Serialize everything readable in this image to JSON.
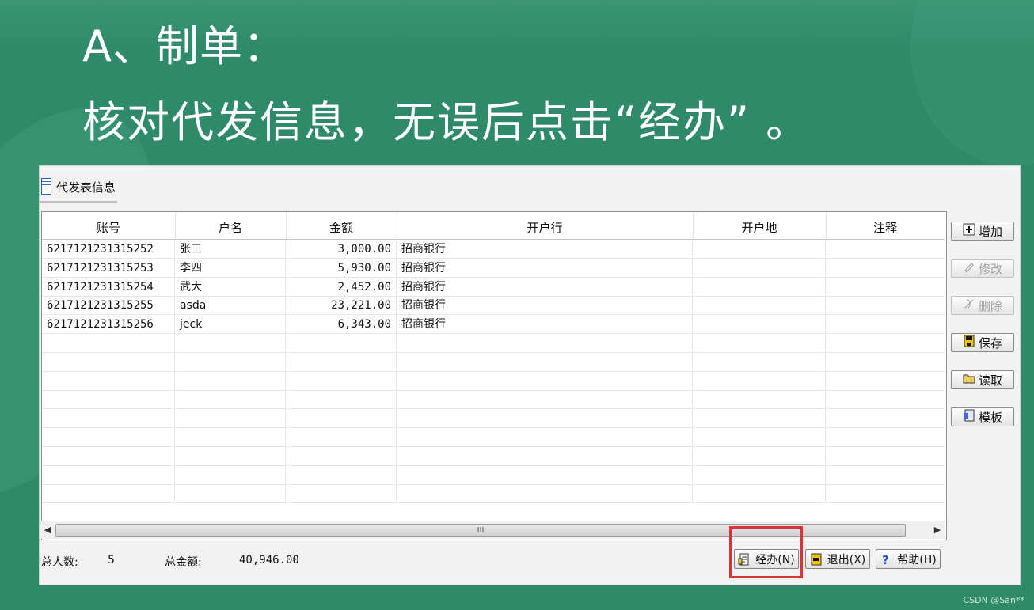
{
  "slide": {
    "title": "A、制单：",
    "subtitle": "核对代发信息，无误后点击“经办”  。"
  },
  "window": {
    "tab_label": "代发表信息",
    "columns": [
      "账号",
      "户名",
      "金额",
      "开户行",
      "开户地",
      "注释"
    ],
    "rows": [
      {
        "account": "6217121231315252",
        "name": "张三",
        "amount": "3,000.00",
        "bank": "招商银行",
        "location": "",
        "note": ""
      },
      {
        "account": "6217121231315253",
        "name": "李四",
        "amount": "5,930.00",
        "bank": "招商银行",
        "location": "",
        "note": ""
      },
      {
        "account": "6217121231315254",
        "name": "武大",
        "amount": "2,452.00",
        "bank": "招商银行",
        "location": "",
        "note": ""
      },
      {
        "account": "6217121231315255",
        "name": "asda",
        "amount": "23,221.00",
        "bank": "招商银行",
        "location": "",
        "note": ""
      },
      {
        "account": "6217121231315256",
        "name": "jeck",
        "amount": "6,343.00",
        "bank": "招商银行",
        "location": "",
        "note": ""
      }
    ],
    "scroll_thumb_text": "III",
    "side_buttons": [
      {
        "label": "增加",
        "icon": "add-icon",
        "enabled": true
      },
      {
        "label": "修改",
        "icon": "edit-icon",
        "enabled": false
      },
      {
        "label": "删除",
        "icon": "delete-icon",
        "enabled": false
      },
      {
        "label": "保存",
        "icon": "save-icon",
        "enabled": true
      },
      {
        "label": "读取",
        "icon": "folder-icon",
        "enabled": true
      },
      {
        "label": "模板",
        "icon": "template-icon",
        "enabled": true
      }
    ],
    "footer": {
      "total_people_label": "总人数:",
      "total_people_value": "5",
      "total_amount_label": "总金额:",
      "total_amount_value": "40,946.00",
      "buttons": [
        {
          "label": "经办(N)",
          "icon": "handle-icon"
        },
        {
          "label": "退出(X)",
          "icon": "exit-icon"
        },
        {
          "label": "帮助(H)",
          "icon": "help-icon"
        }
      ]
    },
    "highlight_color": "#d9343a"
  },
  "watermark": "CSDN @San**"
}
